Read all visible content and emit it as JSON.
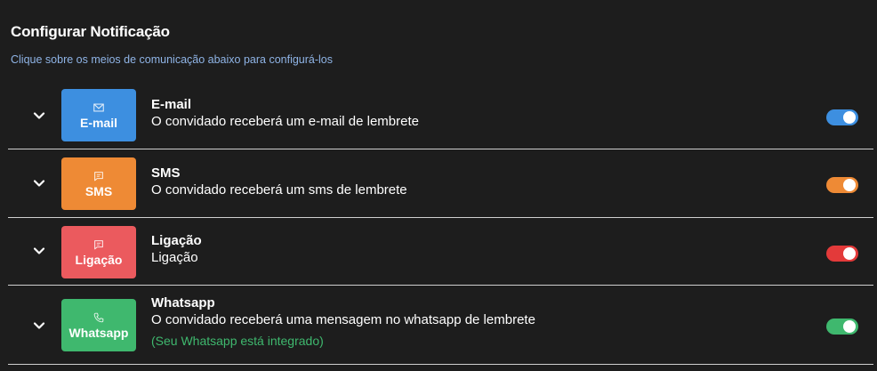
{
  "header": {
    "title": "Configurar Notificação",
    "subtitle": "Clique sobre os meios de comunicação abaixo para configurá-los"
  },
  "channels": [
    {
      "badge_label": "E-mail",
      "badge_icon": "envelope-icon",
      "name": "E-mail",
      "description": "O convidado receberá um e-mail de lembrete",
      "color": "#3d8fe0",
      "enabled": true
    },
    {
      "badge_label": "SMS",
      "badge_icon": "message-icon",
      "name": "SMS",
      "description": "O convidado receberá um sms de lembrete",
      "color": "#ee8a35",
      "enabled": true
    },
    {
      "badge_label": "Ligação",
      "badge_icon": "message-icon",
      "name": "Ligação",
      "description": "Ligação",
      "color": "#eb5a5e",
      "toggle_color": "#e33a3a",
      "enabled": true
    },
    {
      "badge_label": "Whatsapp",
      "badge_icon": "phone-icon",
      "name": "Whatsapp",
      "description": "O convidado receberá uma mensagem no whatsapp de lembrete",
      "extra": "(Seu Whatsapp está integrado)",
      "extra_color": "#3fb86e",
      "color": "#3fb86e",
      "enabled": true
    }
  ]
}
